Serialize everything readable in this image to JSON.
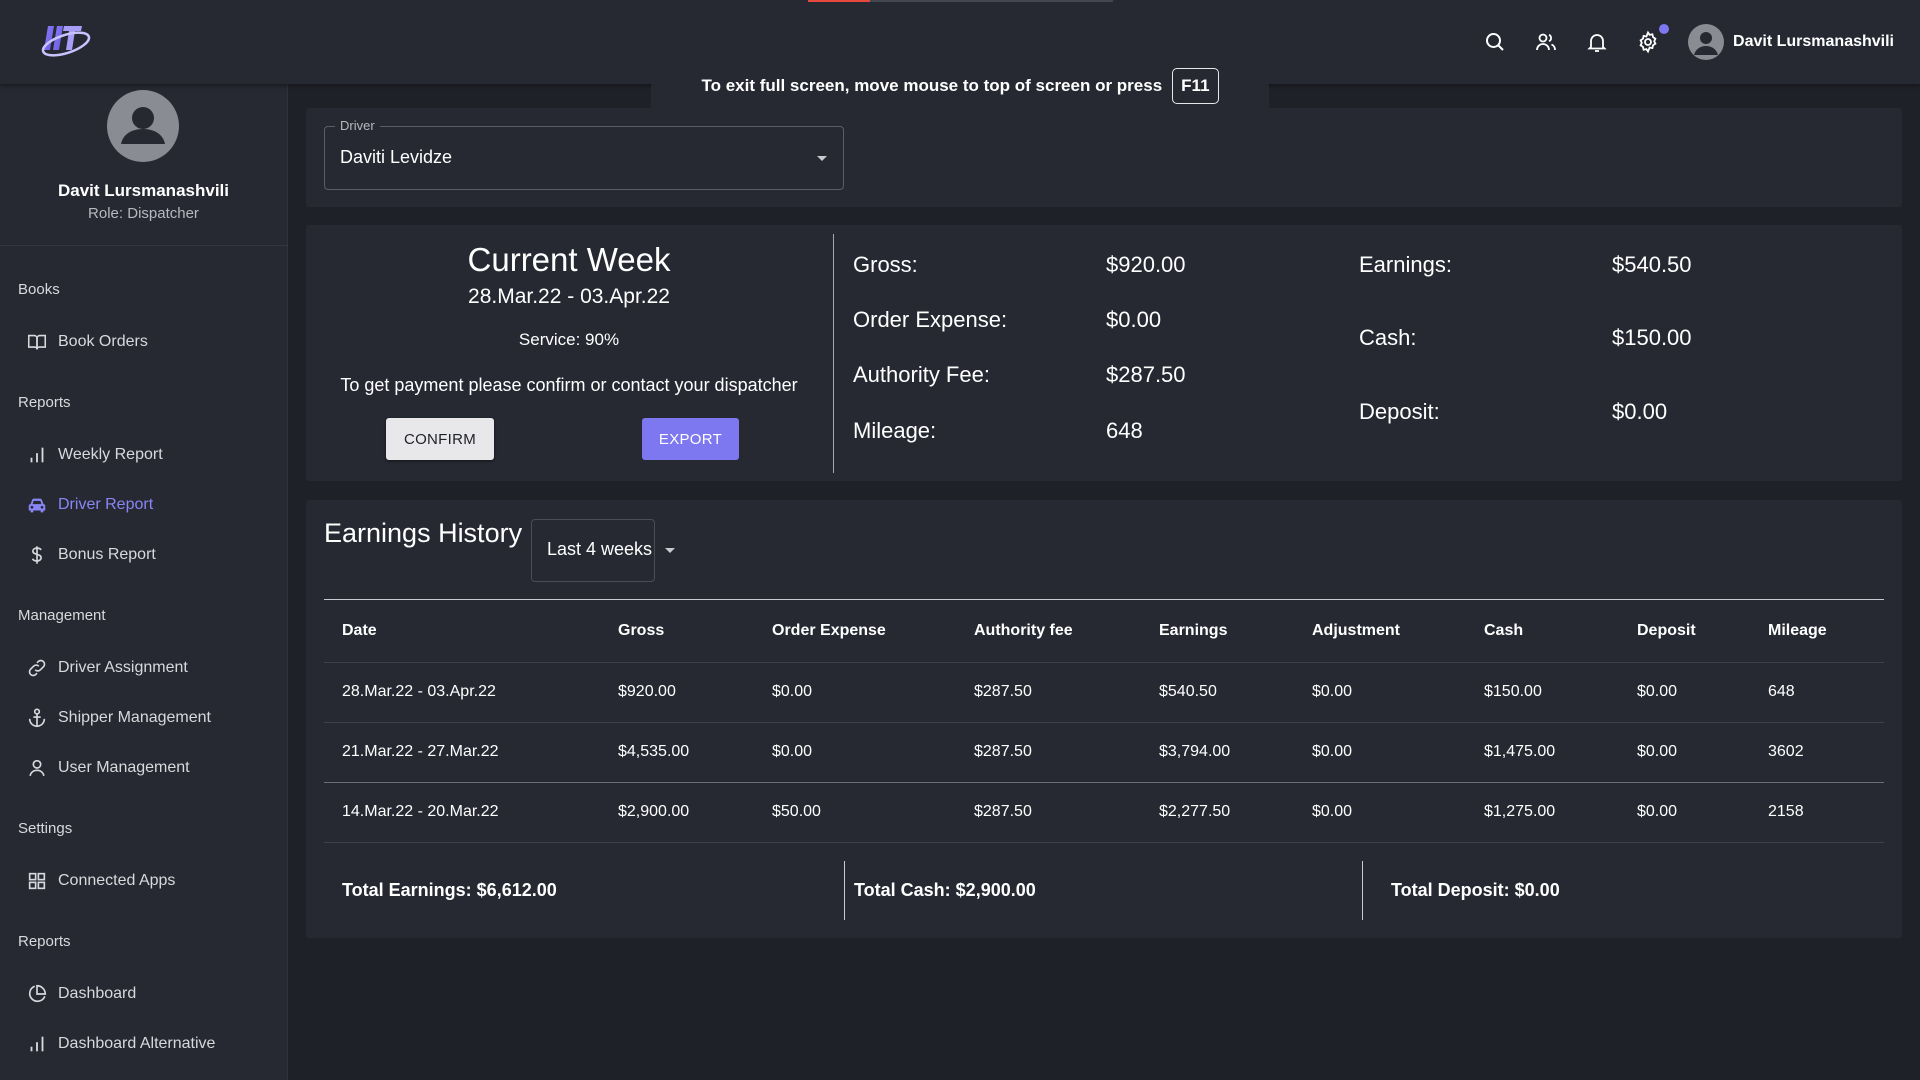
{
  "topbar": {
    "user_name": "Davit Lursmanashvili",
    "fullscreen_notice": "To exit full screen, move mouse to top of screen or press",
    "fullscreen_key": "F11",
    "accent": "#7d78f0"
  },
  "sidebar": {
    "profile": {
      "name": "Davit Lursmanashvili",
      "role": "Role: Dispatcher"
    },
    "sections": [
      {
        "title": "Books",
        "items": [
          {
            "label": "Book Orders",
            "icon": "book-icon"
          }
        ]
      },
      {
        "title": "Reports",
        "items": [
          {
            "label": "Weekly Report",
            "icon": "bar-chart-icon"
          },
          {
            "label": "Driver Report",
            "icon": "car-icon",
            "active": true
          },
          {
            "label": "Bonus Report",
            "icon": "dollar-icon"
          }
        ]
      },
      {
        "title": "Management",
        "items": [
          {
            "label": "Driver Assignment",
            "icon": "link-icon"
          },
          {
            "label": "Shipper Management",
            "icon": "anchor-icon"
          },
          {
            "label": "User Management",
            "icon": "user-icon"
          }
        ]
      },
      {
        "title": "Settings",
        "items": [
          {
            "label": "Connected Apps",
            "icon": "grid-icon"
          }
        ]
      },
      {
        "title": "Reports",
        "items": [
          {
            "label": "Dashboard",
            "icon": "pie-chart-icon"
          },
          {
            "label": "Dashboard Alternative",
            "icon": "bar-chart-icon"
          }
        ]
      }
    ]
  },
  "driver_filter": {
    "label": "Driver",
    "value": "Daviti Levidze"
  },
  "current_week": {
    "title": "Current Week",
    "range": "28.Mar.22 - 03.Apr.22",
    "service": "Service: 90%",
    "message": "To get payment please confirm or contact your dispatcher",
    "confirm_label": "CONFIRM",
    "export_label": "EXPORT",
    "stats_left": [
      {
        "label": "Gross:",
        "value": "$920.00"
      },
      {
        "label": "Order Expense:",
        "value": "$0.00"
      },
      {
        "label": "Authority Fee:",
        "value": "$287.50"
      },
      {
        "label": "Mileage:",
        "value": "648"
      }
    ],
    "stats_right": [
      {
        "label": "Earnings:",
        "value": "$540.50"
      },
      {
        "label": "Cash:",
        "value": "$150.00"
      },
      {
        "label": "Deposit:",
        "value": "$0.00"
      }
    ]
  },
  "history": {
    "title": "Earnings History",
    "period": "Last 4 weeks",
    "columns": [
      "Date",
      "Gross",
      "Order Expense",
      "Authority fee",
      "Earnings",
      "Adjustment",
      "Cash",
      "Deposit",
      "Mileage"
    ],
    "rows": [
      [
        "28.Mar.22 - 03.Apr.22",
        "$920.00",
        "$0.00",
        "$287.50",
        "$540.50",
        "$0.00",
        "$150.00",
        "$0.00",
        "648"
      ],
      [
        "21.Mar.22 - 27.Mar.22",
        "$4,535.00",
        "$0.00",
        "$287.50",
        "$3,794.00",
        "$0.00",
        "$1,475.00",
        "$0.00",
        "3602"
      ],
      [
        "14.Mar.22 - 20.Mar.22",
        "$2,900.00",
        "$50.00",
        "$287.50",
        "$2,277.50",
        "$0.00",
        "$1,275.00",
        "$0.00",
        "2158"
      ]
    ],
    "totals": {
      "earnings": "Total Earnings: $6,612.00",
      "cash": "Total Cash: $2,900.00",
      "deposit": "Total Deposit: $0.00"
    }
  }
}
